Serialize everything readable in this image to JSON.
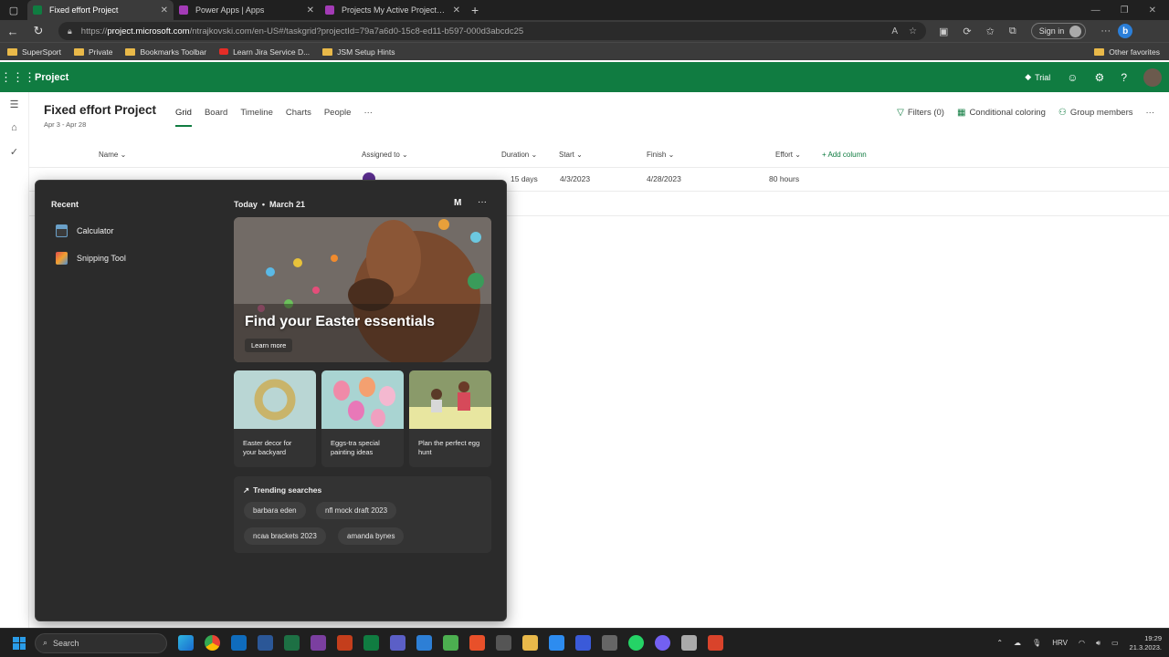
{
  "browser": {
    "tabs": [
      {
        "title": "Fixed effort Project",
        "favicon_color": "#107c41",
        "active": true
      },
      {
        "title": "Power Apps | Apps",
        "favicon_color": "#a33bb6",
        "active": false
      },
      {
        "title": "Projects My Active Projects - Po",
        "favicon_color": "#a33bb6",
        "active": false
      }
    ],
    "url_prefix": "https://",
    "url_host": "project.microsoft.com",
    "url_rest": "/ntrajkovski.com/en-US#/taskgrid?projectId=79a7a6d0-15c8-ed11-b597-000d3abcdc25",
    "signin_label": "Sign in",
    "bookmarks": [
      "SuperSport",
      "Private",
      "Bookmarks Toolbar",
      "Learn Jira Service D...",
      "JSM Setup Hints"
    ],
    "other_favorites": "Other favorites"
  },
  "app": {
    "name": "Project",
    "trial_label": "Trial"
  },
  "project": {
    "title": "Fixed effort Project",
    "dates": "Apr 3 - Apr 28",
    "views": [
      "Grid",
      "Board",
      "Timeline",
      "Charts",
      "People"
    ],
    "active_view": "Grid",
    "filters_label": "Filters (0)",
    "conditional_label": "Conditional coloring",
    "group_label": "Group members"
  },
  "grid": {
    "columns": [
      "Name",
      "Assigned to",
      "Duration",
      "Start",
      "Finish",
      "Effort"
    ],
    "add_column": "Add column",
    "row": {
      "duration": "15 days",
      "start": "4/3/2023",
      "finish": "4/28/2023",
      "effort": "80 hours"
    }
  },
  "start_panel": {
    "recent_heading": "Recent",
    "recent_items": [
      {
        "label": "Calculator",
        "icon": "calculator-icon"
      },
      {
        "label": "Snipping Tool",
        "icon": "snipping-tool-icon"
      }
    ],
    "today_label": "Today",
    "date_label": "March 21",
    "profile_initial": "M",
    "hero": {
      "title": "Find your Easter essentials",
      "button": "Learn more"
    },
    "cards": [
      {
        "caption": "Easter decor for your backyard"
      },
      {
        "caption": "Eggs-tra special painting ideas"
      },
      {
        "caption": "Plan the perfect egg hunt"
      }
    ],
    "trending_heading": "Trending searches",
    "trending": [
      "barbara eden",
      "nfl mock draft 2023",
      "ncaa brackets 2023",
      "amanda bynes"
    ]
  },
  "taskbar": {
    "search_placeholder": "Search",
    "language": "HRV",
    "time": "19:29",
    "date": "21.3.2023."
  }
}
